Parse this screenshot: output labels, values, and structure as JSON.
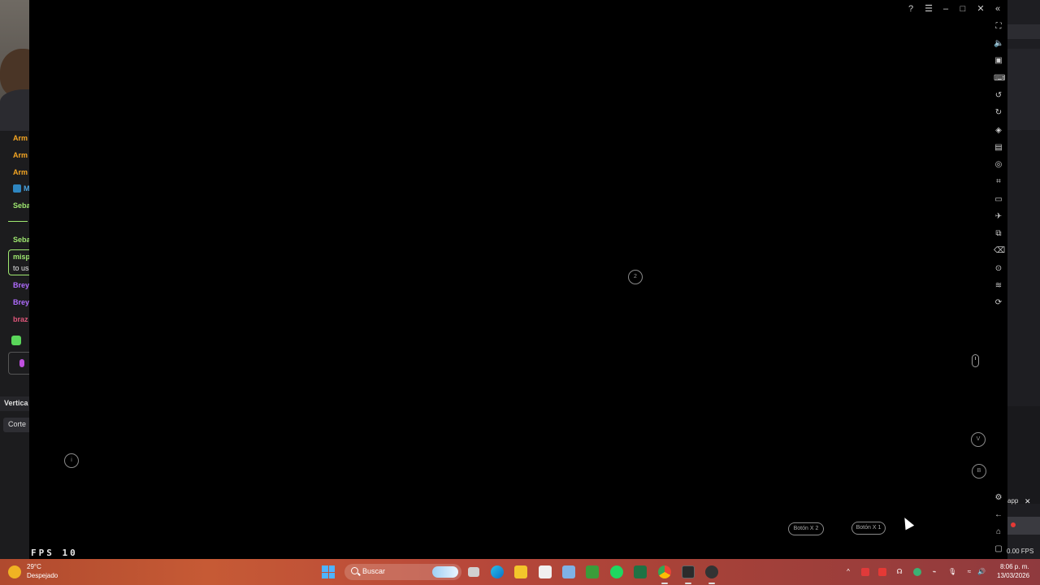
{
  "left_panel": {
    "chat": [
      {
        "name": "Arm",
        "color": "#f5a623"
      },
      {
        "name": "Arm",
        "color": "#f5a623"
      },
      {
        "name": "Arm",
        "color": "#f5a623"
      },
      {
        "name": "M",
        "color": "#4aa3df"
      },
      {
        "name": "Seba",
        "color": "#9fe870"
      },
      {
        "name": "Seba",
        "color": "#9fe870"
      },
      {
        "name": "misp",
        "color": "#9fe870"
      },
      {
        "name": "to us",
        "color": "#e8e8e8"
      },
      {
        "name": "Brey",
        "color": "#b06cff"
      },
      {
        "name": "Brey",
        "color": "#b06cff"
      },
      {
        "name": "braz",
        "color": "#e0567a"
      }
    ],
    "vertical_label": "Vertica",
    "corte_label": "Corte"
  },
  "viewport": {
    "marker_2": "2",
    "marker_i": "i",
    "marker_v": "V",
    "marker_b": "B",
    "button_x2": "Botón X 2",
    "button_x1": "Botón X 1",
    "fps_label": "FPS  10"
  },
  "right_strip": {
    "app_label": "app",
    "close_label": "✕",
    "fps_value": "0.00 FPS"
  },
  "taskbar": {
    "weather_temp": "29°C",
    "weather_desc": "Despejado",
    "search_placeholder": "Buscar",
    "clock_time": "8:06 p. m.",
    "clock_date": "13/03/2026"
  }
}
